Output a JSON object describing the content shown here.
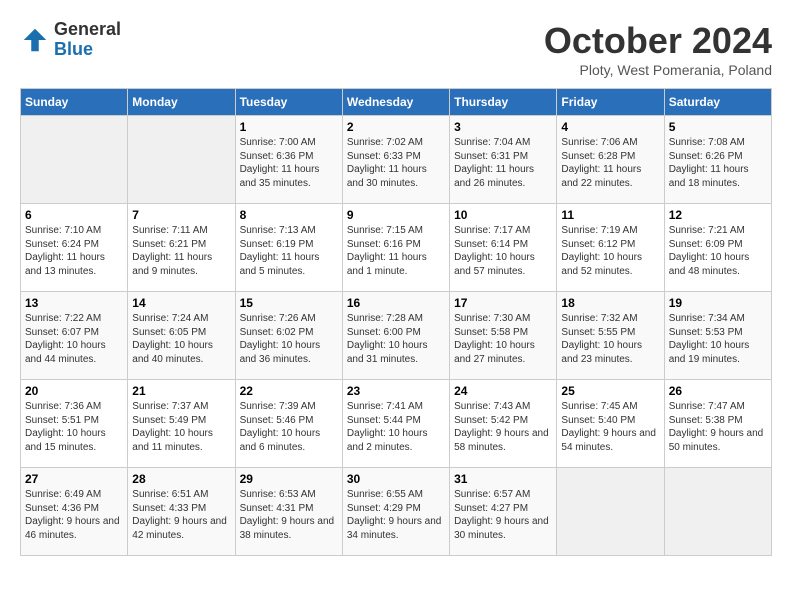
{
  "header": {
    "logo_general": "General",
    "logo_blue": "Blue",
    "month_title": "October 2024",
    "subtitle": "Ploty, West Pomerania, Poland"
  },
  "days_of_week": [
    "Sunday",
    "Monday",
    "Tuesday",
    "Wednesday",
    "Thursday",
    "Friday",
    "Saturday"
  ],
  "weeks": [
    [
      {
        "day": "",
        "info": ""
      },
      {
        "day": "",
        "info": ""
      },
      {
        "day": "1",
        "info": "Sunrise: 7:00 AM\nSunset: 6:36 PM\nDaylight: 11 hours and 35 minutes."
      },
      {
        "day": "2",
        "info": "Sunrise: 7:02 AM\nSunset: 6:33 PM\nDaylight: 11 hours and 30 minutes."
      },
      {
        "day": "3",
        "info": "Sunrise: 7:04 AM\nSunset: 6:31 PM\nDaylight: 11 hours and 26 minutes."
      },
      {
        "day": "4",
        "info": "Sunrise: 7:06 AM\nSunset: 6:28 PM\nDaylight: 11 hours and 22 minutes."
      },
      {
        "day": "5",
        "info": "Sunrise: 7:08 AM\nSunset: 6:26 PM\nDaylight: 11 hours and 18 minutes."
      }
    ],
    [
      {
        "day": "6",
        "info": "Sunrise: 7:10 AM\nSunset: 6:24 PM\nDaylight: 11 hours and 13 minutes."
      },
      {
        "day": "7",
        "info": "Sunrise: 7:11 AM\nSunset: 6:21 PM\nDaylight: 11 hours and 9 minutes."
      },
      {
        "day": "8",
        "info": "Sunrise: 7:13 AM\nSunset: 6:19 PM\nDaylight: 11 hours and 5 minutes."
      },
      {
        "day": "9",
        "info": "Sunrise: 7:15 AM\nSunset: 6:16 PM\nDaylight: 11 hours and 1 minute."
      },
      {
        "day": "10",
        "info": "Sunrise: 7:17 AM\nSunset: 6:14 PM\nDaylight: 10 hours and 57 minutes."
      },
      {
        "day": "11",
        "info": "Sunrise: 7:19 AM\nSunset: 6:12 PM\nDaylight: 10 hours and 52 minutes."
      },
      {
        "day": "12",
        "info": "Sunrise: 7:21 AM\nSunset: 6:09 PM\nDaylight: 10 hours and 48 minutes."
      }
    ],
    [
      {
        "day": "13",
        "info": "Sunrise: 7:22 AM\nSunset: 6:07 PM\nDaylight: 10 hours and 44 minutes."
      },
      {
        "day": "14",
        "info": "Sunrise: 7:24 AM\nSunset: 6:05 PM\nDaylight: 10 hours and 40 minutes."
      },
      {
        "day": "15",
        "info": "Sunrise: 7:26 AM\nSunset: 6:02 PM\nDaylight: 10 hours and 36 minutes."
      },
      {
        "day": "16",
        "info": "Sunrise: 7:28 AM\nSunset: 6:00 PM\nDaylight: 10 hours and 31 minutes."
      },
      {
        "day": "17",
        "info": "Sunrise: 7:30 AM\nSunset: 5:58 PM\nDaylight: 10 hours and 27 minutes."
      },
      {
        "day": "18",
        "info": "Sunrise: 7:32 AM\nSunset: 5:55 PM\nDaylight: 10 hours and 23 minutes."
      },
      {
        "day": "19",
        "info": "Sunrise: 7:34 AM\nSunset: 5:53 PM\nDaylight: 10 hours and 19 minutes."
      }
    ],
    [
      {
        "day": "20",
        "info": "Sunrise: 7:36 AM\nSunset: 5:51 PM\nDaylight: 10 hours and 15 minutes."
      },
      {
        "day": "21",
        "info": "Sunrise: 7:37 AM\nSunset: 5:49 PM\nDaylight: 10 hours and 11 minutes."
      },
      {
        "day": "22",
        "info": "Sunrise: 7:39 AM\nSunset: 5:46 PM\nDaylight: 10 hours and 6 minutes."
      },
      {
        "day": "23",
        "info": "Sunrise: 7:41 AM\nSunset: 5:44 PM\nDaylight: 10 hours and 2 minutes."
      },
      {
        "day": "24",
        "info": "Sunrise: 7:43 AM\nSunset: 5:42 PM\nDaylight: 9 hours and 58 minutes."
      },
      {
        "day": "25",
        "info": "Sunrise: 7:45 AM\nSunset: 5:40 PM\nDaylight: 9 hours and 54 minutes."
      },
      {
        "day": "26",
        "info": "Sunrise: 7:47 AM\nSunset: 5:38 PM\nDaylight: 9 hours and 50 minutes."
      }
    ],
    [
      {
        "day": "27",
        "info": "Sunrise: 6:49 AM\nSunset: 4:36 PM\nDaylight: 9 hours and 46 minutes."
      },
      {
        "day": "28",
        "info": "Sunrise: 6:51 AM\nSunset: 4:33 PM\nDaylight: 9 hours and 42 minutes."
      },
      {
        "day": "29",
        "info": "Sunrise: 6:53 AM\nSunset: 4:31 PM\nDaylight: 9 hours and 38 minutes."
      },
      {
        "day": "30",
        "info": "Sunrise: 6:55 AM\nSunset: 4:29 PM\nDaylight: 9 hours and 34 minutes."
      },
      {
        "day": "31",
        "info": "Sunrise: 6:57 AM\nSunset: 4:27 PM\nDaylight: 9 hours and 30 minutes."
      },
      {
        "day": "",
        "info": ""
      },
      {
        "day": "",
        "info": ""
      }
    ]
  ]
}
